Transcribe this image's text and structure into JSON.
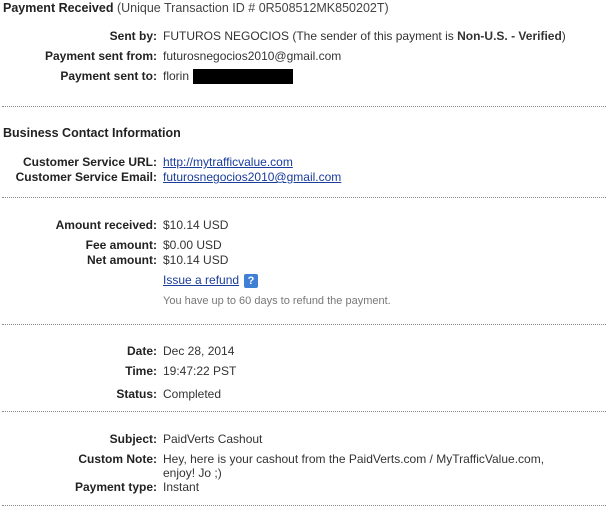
{
  "header": {
    "title": "Payment Received",
    "transaction": "(Unique Transaction ID # 0R508512MK850202T)"
  },
  "sender": {
    "sent_by_label": "Sent by:",
    "sent_by_name": "FUTUROS NEGOCIOS",
    "sent_by_note_pre": "(The sender of this payment is ",
    "sent_by_note_bold": "Non-U.S. - Verified",
    "sent_by_note_post": ")",
    "sent_from_label": "Payment sent from:",
    "sent_from_value": "futurosnegocios2010@gmail.com",
    "sent_to_label": "Payment sent to:",
    "sent_to_value": "florin"
  },
  "business": {
    "title": "Business Contact Information",
    "url_label": "Customer Service URL:",
    "url_value": "http://mytrafficvalue.com",
    "email_label": "Customer Service Email:",
    "email_value": "futurosnegocios2010@gmail.com"
  },
  "amounts": {
    "received_label": "Amount received:",
    "received_value": "$10.14 USD",
    "fee_label": "Fee amount:",
    "fee_value": "$0.00 USD",
    "net_label": "Net amount:",
    "net_value": "$10.14 USD",
    "refund_link": "Issue a refund",
    "help_icon": "?",
    "refund_note": "You have up to 60 days to refund the payment."
  },
  "datetime": {
    "date_label": "Date:",
    "date_value": "Dec 28, 2014",
    "time_label": "Time:",
    "time_value": "19:47:22 PST",
    "status_label": "Status:",
    "status_value": "Completed"
  },
  "details": {
    "subject_label": "Subject:",
    "subject_value": "PaidVerts Cashout",
    "note_label": "Custom Note:",
    "note_line1": "Hey, here is your cashout from the PaidVerts.com / MyTrafficValue.com,",
    "note_line2": "enjoy! Jo ;)",
    "type_label": "Payment type:",
    "type_value": "Instant"
  }
}
